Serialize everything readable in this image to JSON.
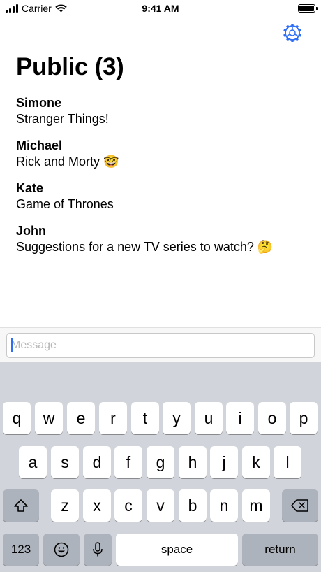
{
  "status_bar": {
    "carrier": "Carrier",
    "time": "9:41 AM",
    "battery_level": 1.0
  },
  "channel": {
    "title": "Public (3)"
  },
  "messages": [
    {
      "author": "Simone",
      "text": "Stranger Things!"
    },
    {
      "author": "Michael",
      "text": "Rick and Morty 🤓"
    },
    {
      "author": "Kate",
      "text": "Game of Thrones"
    },
    {
      "author": "John",
      "text": "Suggestions for a new TV series to watch? 🤔"
    }
  ],
  "composer": {
    "placeholder": "Message",
    "value": ""
  },
  "keyboard": {
    "row1": [
      "q",
      "w",
      "e",
      "r",
      "t",
      "y",
      "u",
      "i",
      "o",
      "p"
    ],
    "row2": [
      "a",
      "s",
      "d",
      "f",
      "g",
      "h",
      "j",
      "k",
      "l"
    ],
    "row3": [
      "z",
      "x",
      "c",
      "v",
      "b",
      "n",
      "m"
    ],
    "numbers_label": "123",
    "space_label": "space",
    "return_label": "return"
  },
  "icons": {
    "settings": "gear-icon",
    "shift": "shift-icon",
    "delete": "backspace-icon",
    "emoji": "emoji-icon",
    "dictation": "microphone-icon"
  },
  "colors": {
    "accent": "#2e6df6",
    "keyboard_bg": "#d1d4da",
    "special_key": "#adb3bc"
  }
}
